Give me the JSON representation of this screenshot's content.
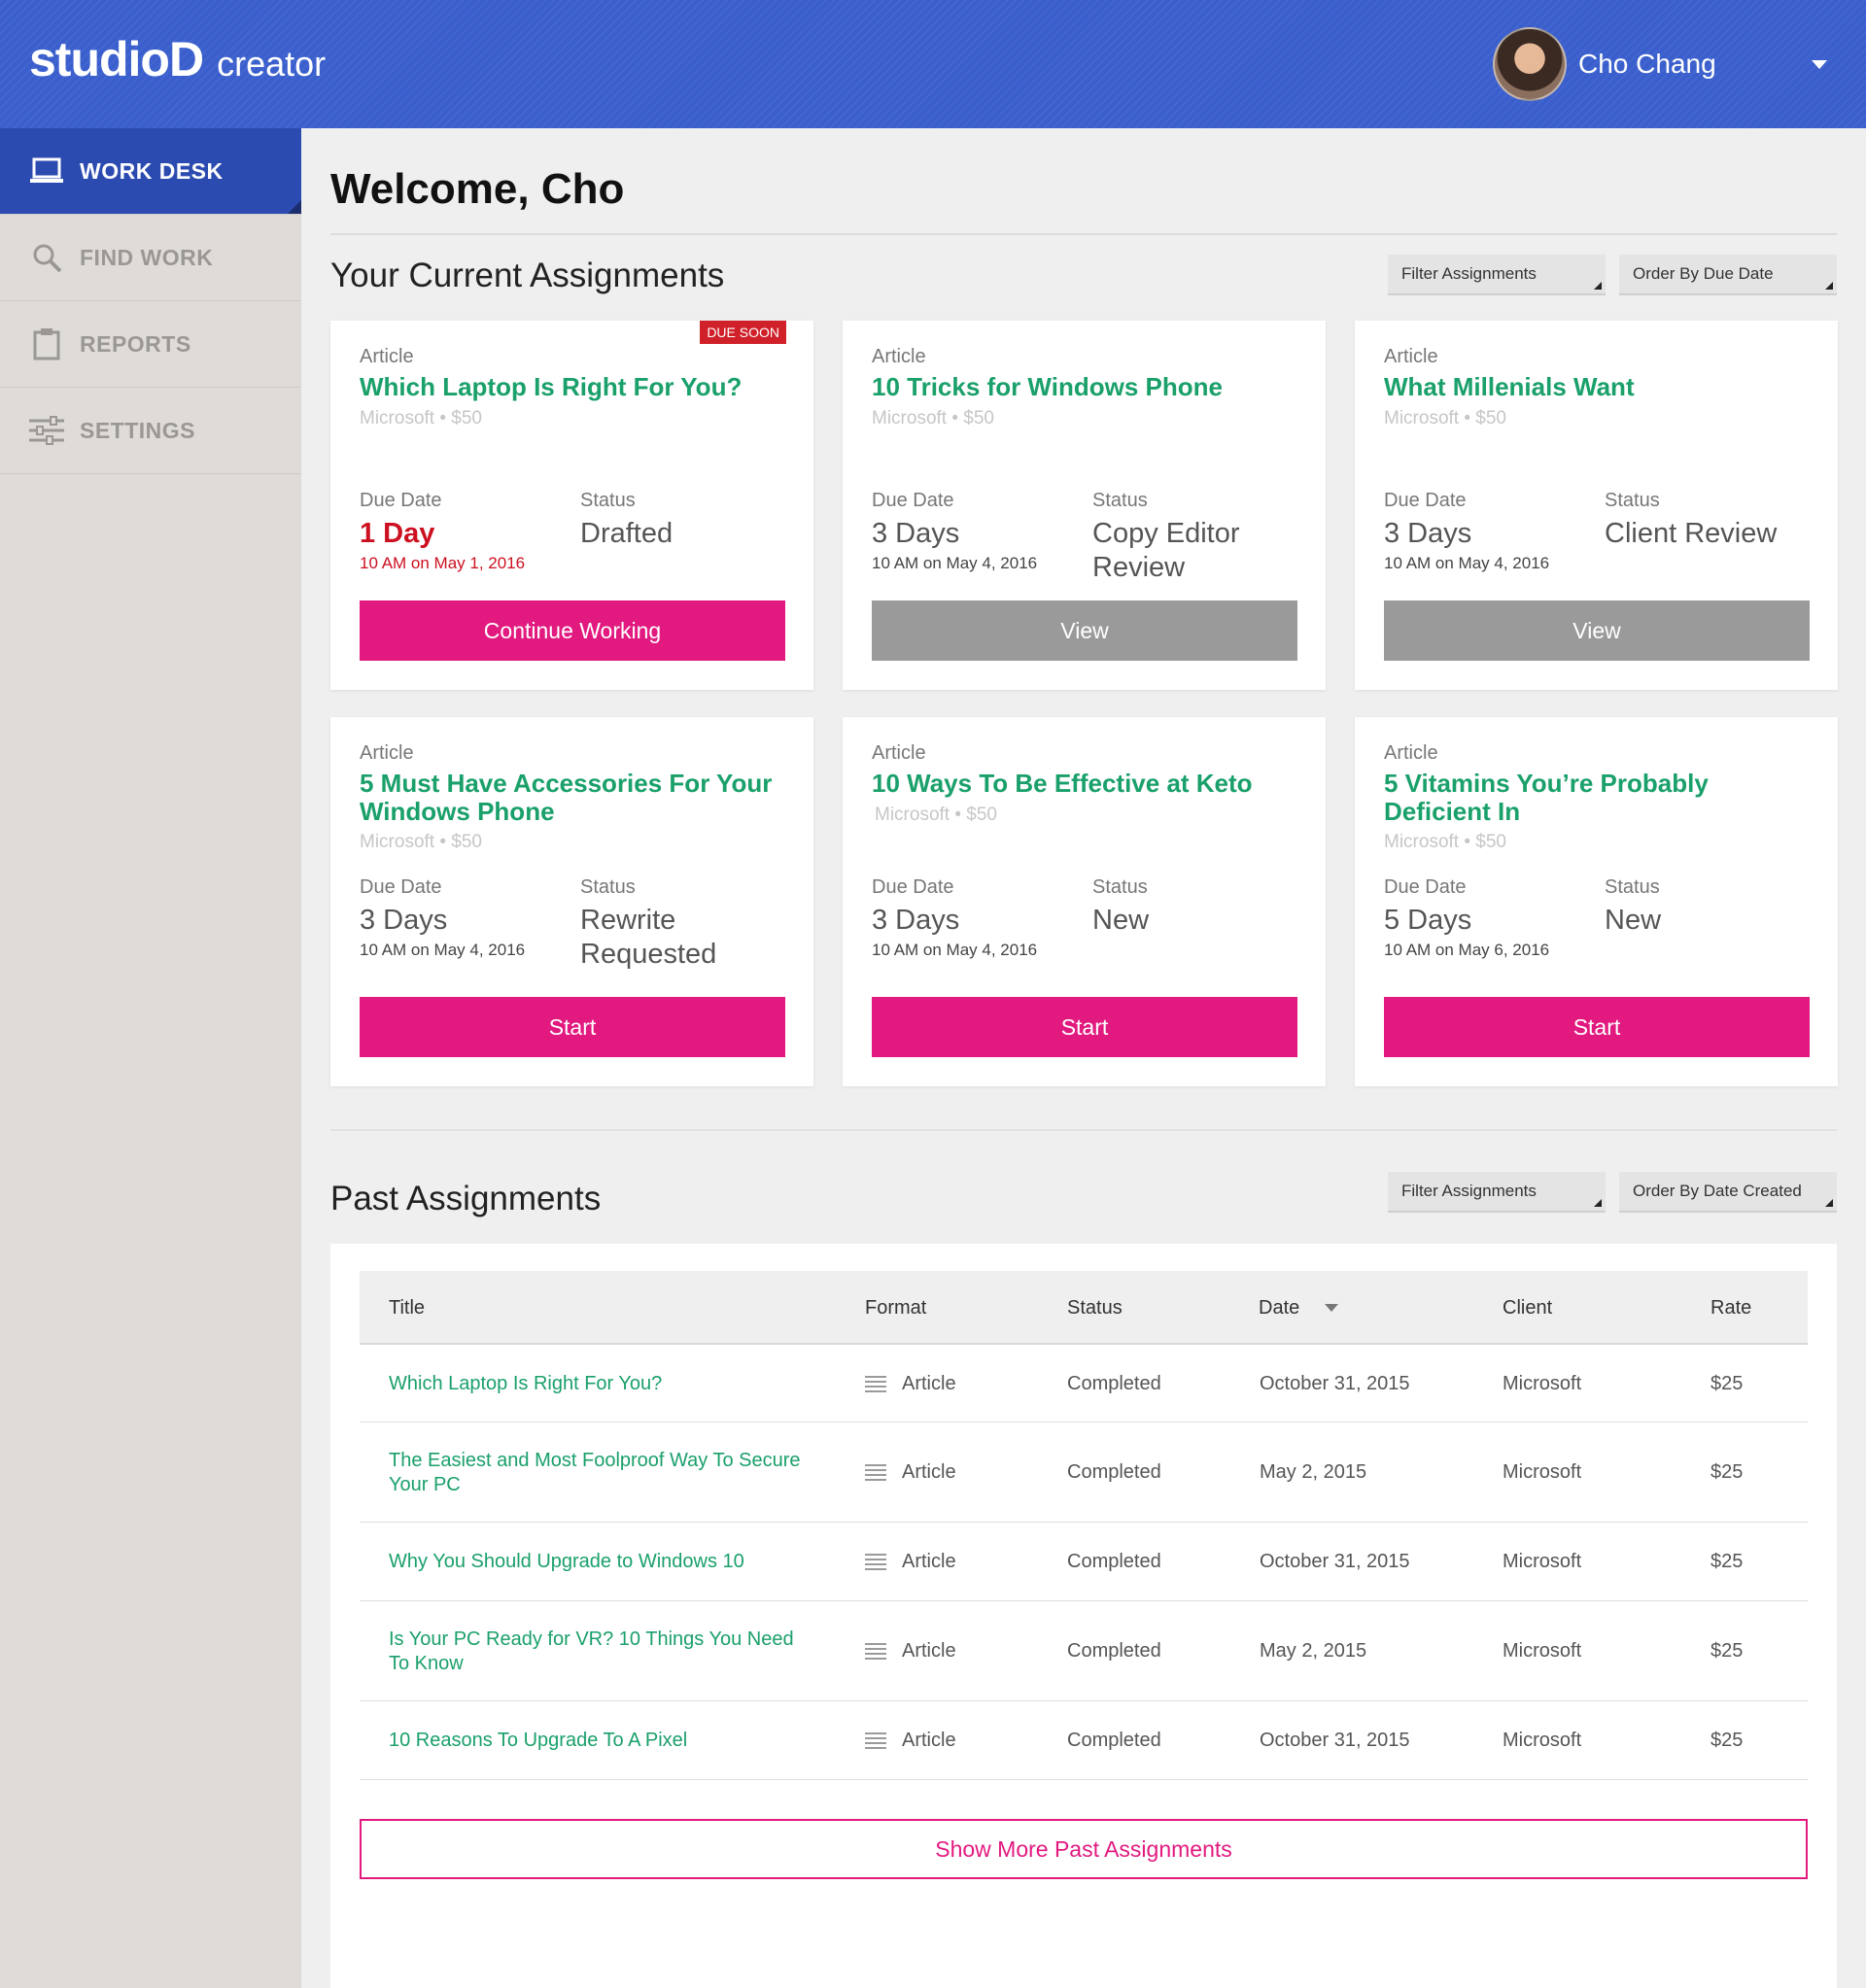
{
  "header": {
    "logo_main": "studioD",
    "logo_sub": "creator",
    "user_name": "Cho Chang"
  },
  "sidebar": {
    "items": [
      {
        "label": "WORK DESK",
        "icon": "laptop-icon",
        "active": true
      },
      {
        "label": "FIND WORK",
        "icon": "search-icon",
        "active": false
      },
      {
        "label": "REPORTS",
        "icon": "clipboard-icon",
        "active": false
      },
      {
        "label": "SETTINGS",
        "icon": "sliders-icon",
        "active": false
      }
    ]
  },
  "main": {
    "welcome": "Welcome, Cho",
    "current": {
      "title": "Your Current Assignments",
      "filter_label": "Filter Assignments",
      "order_label": "Order By Due Date",
      "labels": {
        "due_date": "Due Date",
        "status": "Status"
      },
      "cards": [
        {
          "type": "Article",
          "title": "Which Laptop Is Right For You?",
          "client": "Microsoft • $50",
          "badge": "DUE SOON",
          "due": "1 Day",
          "due_time": "10 AM on May 1, 2016",
          "status": "Drafted",
          "button": "Continue Working"
        },
        {
          "type": "Article",
          "title": "10 Tricks for Windows Phone",
          "client": "Microsoft • $50",
          "due": "3 Days",
          "due_time": "10 AM on May 4, 2016",
          "status": "Copy Editor Review",
          "button": "View"
        },
        {
          "type": "Article",
          "title": "What Millenials Want",
          "client": "Microsoft • $50",
          "due": "3 Days",
          "due_time": "10 AM on May 4, 2016",
          "status": "Client Review",
          "button": "View"
        },
        {
          "type": "Article",
          "title": "5 Must Have Accessories For Your Windows Phone",
          "client": "Microsoft • $50",
          "due": "3 Days",
          "due_time": "10 AM on May 4, 2016",
          "status": "Rewrite Requested",
          "button": "Start"
        },
        {
          "type": "Article",
          "title": "10 Ways To Be Effective at Keto",
          "client": "Microsoft • $50",
          "due": "3 Days",
          "due_time": "10 AM on May 4, 2016",
          "status": "New",
          "button": "Start"
        },
        {
          "type": "Article",
          "title": "5 Vitamins You’re Probably Deficient In",
          "client": "Microsoft • $50",
          "due": "5 Days",
          "due_time": "10 AM on May 6, 2016",
          "status": "New",
          "button": "Start"
        }
      ]
    },
    "past": {
      "title": "Past Assignments",
      "filter_label": "Filter Assignments",
      "order_label": "Order By Date Created",
      "columns": [
        "Title",
        "Format",
        "Status",
        "Date",
        "Client",
        "Rate"
      ],
      "rows": [
        {
          "title": "Which Laptop Is Right For You?",
          "format": "Article",
          "status": "Completed",
          "date": "October 31, 2015",
          "client": "Microsoft",
          "rate": "$25"
        },
        {
          "title": "The Easiest and Most Foolproof Way To Secure Your PC",
          "format": "Article",
          "status": "Completed",
          "date": "May 2, 2015",
          "client": "Microsoft",
          "rate": "$25"
        },
        {
          "title": "Why You Should Upgrade to Windows 10",
          "format": "Article",
          "status": "Completed",
          "date": "October 31, 2015",
          "client": "Microsoft",
          "rate": "$25"
        },
        {
          "title": "Is Your PC Ready for VR? 10 Things You Need To Know",
          "format": "Article",
          "status": "Completed",
          "date": "May 2, 2015",
          "client": "Microsoft",
          "rate": "$25"
        },
        {
          "title": "10 Reasons To Upgrade To A Pixel",
          "format": "Article",
          "status": "Completed",
          "date": "October 31, 2015",
          "client": "Microsoft",
          "rate": "$25"
        }
      ],
      "show_more": "Show More Past Assignments"
    }
  },
  "colors": {
    "header": "#3a5fcd",
    "accent": "#e2197f",
    "link": "#1aa06a",
    "alert": "#cc1020"
  }
}
